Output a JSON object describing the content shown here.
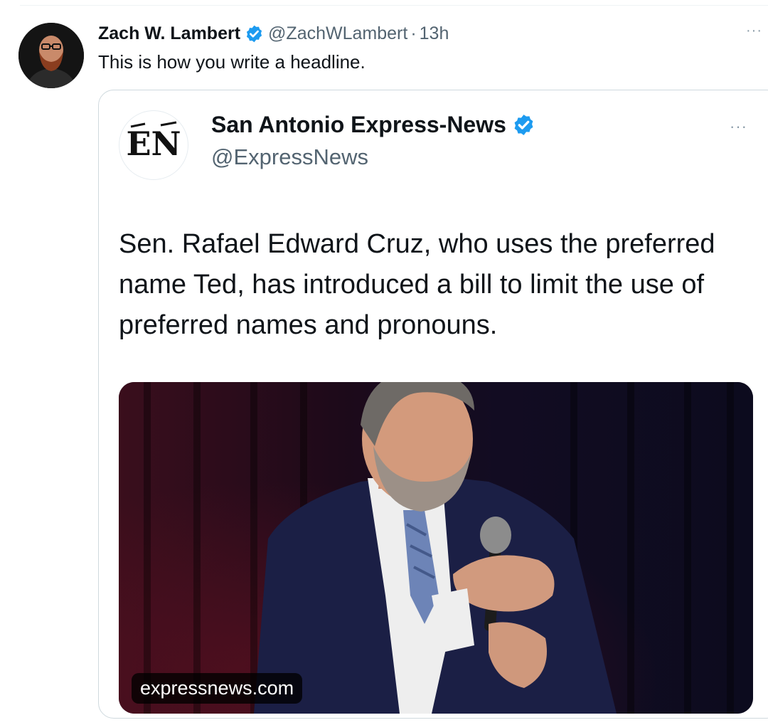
{
  "tweet": {
    "author_name": "Zach W. Lambert",
    "handle": "@ZachWLambert",
    "separator": "·",
    "time": "13h",
    "text": "This is how you write a headline.",
    "more": "···"
  },
  "quoted": {
    "author_name": "San Antonio Express-News",
    "handle": "@ExpressNews",
    "logo_text": "EN",
    "text": "Sen. Rafael Edward Cruz, who uses the preferred name Ted, has introduced a bill to limit the use of preferred names and pronouns.",
    "media_domain": "expressnews.com",
    "more": "···"
  },
  "icons": {
    "verified": "verified-badge-icon",
    "more": "more-options-icon"
  },
  "colors": {
    "verified_blue": "#1d9bf0",
    "secondary_text": "#536471",
    "border": "#cfd9de"
  }
}
